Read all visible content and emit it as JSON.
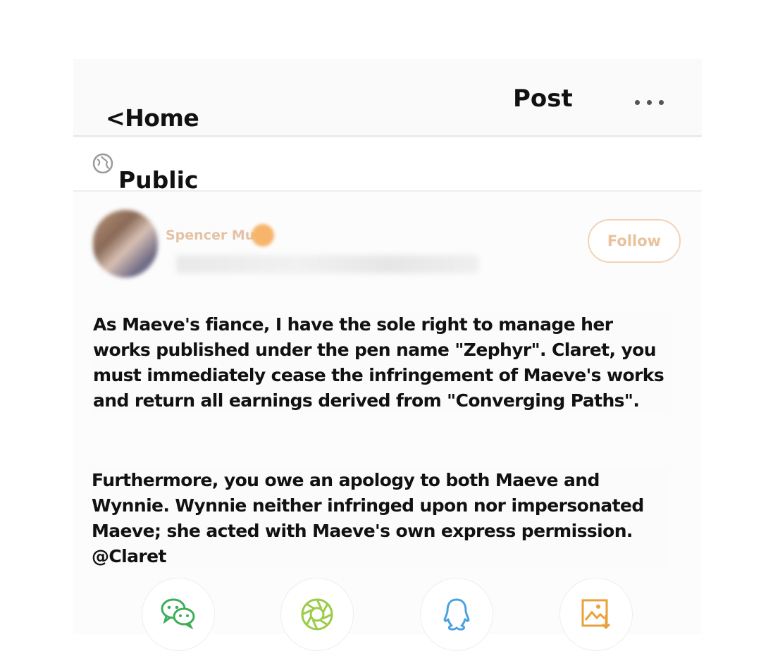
{
  "header": {
    "back_label": "<Home",
    "title": "Post",
    "more_icon": "more-dots-icon"
  },
  "visibility": {
    "icon": "globe-icon",
    "label": "Public"
  },
  "author": {
    "name": "Spencer Mu",
    "follow_label": "Follow",
    "badge_icon": "vip-badge-icon"
  },
  "post": {
    "paragraphs": [
      "As Maeve's fiance, I have the sole right to manage her works published under the pen name \"Zephyr\". Claret, you must immediately cease the infringement of Maeve's works and return all earnings derived from \"Converging Paths\".",
      "Furthermore, you owe an apology to both Maeve and Wynnie. Wynnie neither infringed upon nor impersonated Maeve; she acted with Maeve's own express permission. @Claret"
    ]
  },
  "share": [
    {
      "icon": "wechat-icon",
      "color": "#3fae5a"
    },
    {
      "icon": "moments-icon",
      "color": "#9ccc4a"
    },
    {
      "icon": "qq-icon",
      "color": "#4aa3df"
    },
    {
      "icon": "save-image-icon",
      "color": "#e9a23b"
    }
  ],
  "colors": {
    "accent": "#e8c29a",
    "username": "#e3c3a6"
  }
}
